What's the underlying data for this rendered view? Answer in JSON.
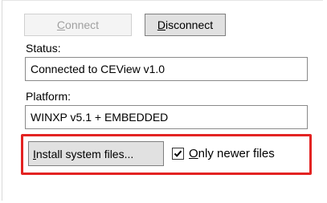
{
  "buttons": {
    "connect": {
      "first": "C",
      "rest": "onnect",
      "enabled": false
    },
    "disconnect": {
      "first": "D",
      "rest": "isconnect",
      "enabled": true
    },
    "install": {
      "first": "I",
      "rest": "nstall system files..."
    }
  },
  "status": {
    "label": "Status:",
    "value": "Connected to CEView v1.0"
  },
  "platform": {
    "label": "Platform:",
    "value": "WINXP v5.1 + EMBEDDED"
  },
  "only_newer": {
    "first": "O",
    "rest": "nly newer files",
    "checked": true
  },
  "colors": {
    "highlight": "#e32322",
    "disabled_text": "#a0a0a0",
    "button_face": "#e1e1e1"
  },
  "icons": {
    "checkmark": "check-icon"
  }
}
